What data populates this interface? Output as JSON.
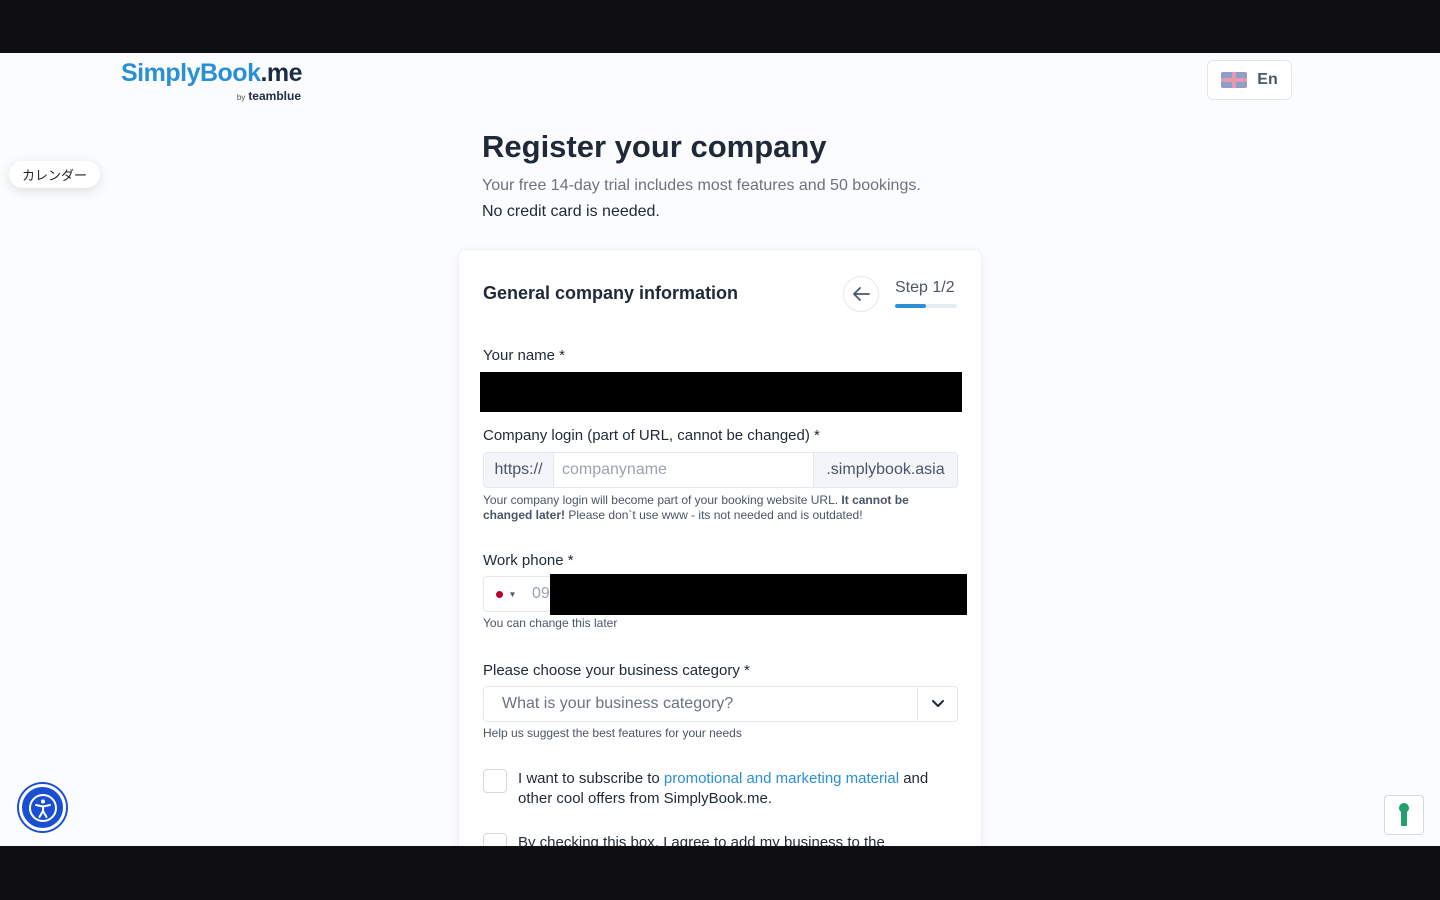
{
  "brand": {
    "logo_main": "SimplyBook",
    "logo_tld": ".me",
    "logo_by": "by",
    "logo_sub": "teamblue"
  },
  "language": {
    "code": "En",
    "flag_icon": "uk-flag-icon"
  },
  "calendar_chip": {
    "label": "カレンダー"
  },
  "page": {
    "title": "Register your company",
    "subtitle": "Your free 14-day trial includes most features and 50 bookings.",
    "subtitle2": "No credit card is needed."
  },
  "card": {
    "title": "General company information",
    "step_label": "Step 1/2",
    "step_progress": 0.5
  },
  "form": {
    "name_label": "Your name *",
    "login_label": "Company login (part of URL, cannot be changed) *",
    "login_prefix": "https://",
    "login_placeholder": "companyname",
    "login_suffix": ".simplybook.asia",
    "login_help_1": "Your company login will become part of your booking website URL. ",
    "login_help_bold": "It cannot be changed later!",
    "login_help_2": " Please don`t use www - its not needed and is outdated!",
    "phone_label": "Work phone *",
    "phone_value_visible": "09",
    "phone_help": "You can change this later",
    "category_label": "Please choose your business category *",
    "category_placeholder": "What is your business category?",
    "category_help": "Help us suggest the best features for your needs",
    "subscribe_pre": "I want to subscribe to ",
    "subscribe_link": "promotional and marketing material",
    "subscribe_post": " and other cool offers from SimplyBook.me.",
    "directory_text": "By checking this box, I agree to add my business to the"
  },
  "colors": {
    "accent": "#2b8fd6",
    "dark_text": "#1f2937",
    "a11y_blue": "#1b4fd3",
    "japan_red": "#bc002d"
  }
}
